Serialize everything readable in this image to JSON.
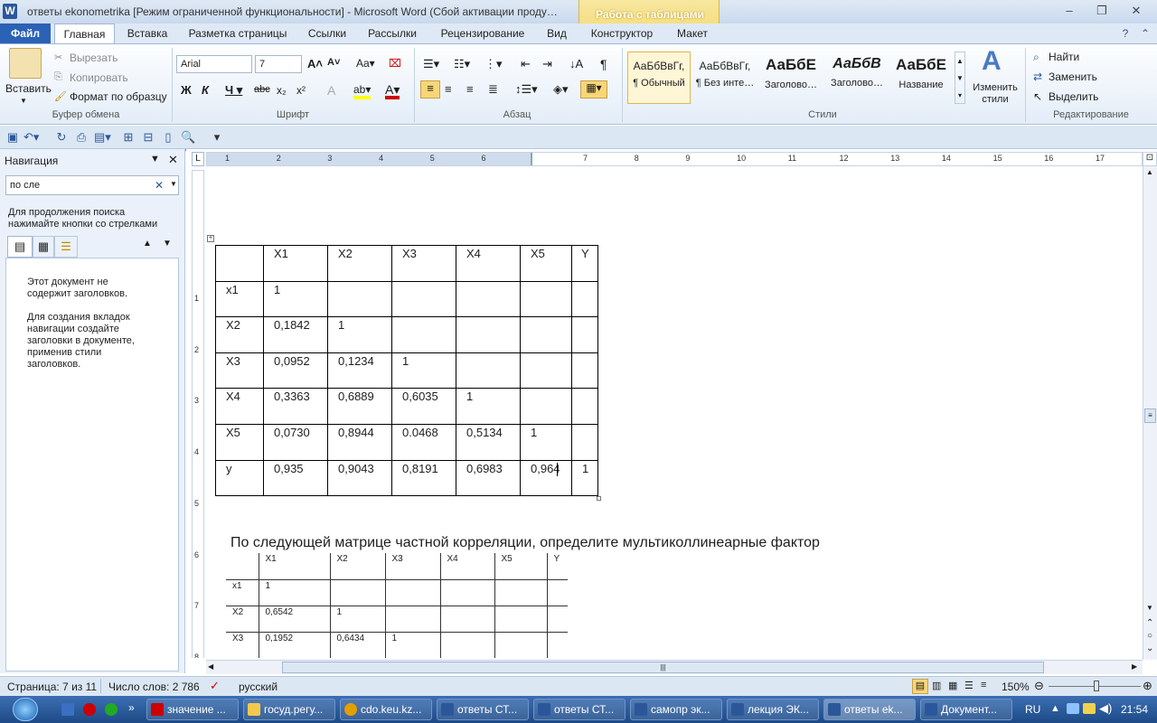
{
  "window": {
    "title": "ответы ekonometrika [Режим ограниченной функциональности]  -  Microsoft Word (Сбой активации проду…",
    "contextual_tab_group": "Работа с таблицами"
  },
  "tabs": [
    "Файл",
    "Главная",
    "Вставка",
    "Разметка страницы",
    "Ссылки",
    "Рассылки",
    "Рецензирование",
    "Вид",
    "Конструктор",
    "Макет"
  ],
  "ribbon": {
    "clipboard": {
      "label": "Буфер обмена",
      "paste": "Вставить",
      "cut": "Вырезать",
      "copy": "Копировать",
      "format_painter": "Формат по образцу"
    },
    "font": {
      "label": "Шрифт",
      "font_name": "Arial",
      "font_size": "7"
    },
    "paragraph": {
      "label": "Абзац"
    },
    "styles": {
      "label": "Стили",
      "items": [
        {
          "sample": "АаБбВвГг,",
          "name": "¶ Обычный"
        },
        {
          "sample": "АаБбВвГг,",
          "name": "¶ Без инте…"
        },
        {
          "sample": "АаБбЕ",
          "name": "Заголово…"
        },
        {
          "sample": "АаБбВ",
          "name": "Заголово…"
        },
        {
          "sample": "АаБбЕ",
          "name": "Название"
        }
      ],
      "change_styles": "Изменить стили"
    },
    "editing": {
      "label": "Редактирование",
      "find": "Найти",
      "replace": "Заменить",
      "select": "Выделить"
    }
  },
  "nav": {
    "title": "Навигация",
    "search_value": "по сле",
    "hint": "Для продолжения поиска нажимайте кнопки со стрелками",
    "no_headings": "Этот документ не содержит заголовков.",
    "create_tabs": "Для создания вкладок навигации создайте заголовки в документе, применив стили заголовков."
  },
  "ruler_numbers": [
    "1",
    "2",
    "3",
    "4",
    "5",
    "6",
    "7",
    "8",
    "9",
    "10",
    "11",
    "12",
    "13",
    "14",
    "15",
    "16",
    "17"
  ],
  "vruler_numbers": [
    "1",
    "2",
    "3",
    "4",
    "5",
    "6",
    "7",
    "8"
  ],
  "table1": {
    "header": [
      "",
      "X1",
      "X2",
      "X3",
      "X4",
      "X5",
      "Y"
    ],
    "rows": [
      [
        "x1",
        "1",
        "",
        "",
        "",
        "",
        ""
      ],
      [
        "X2",
        "0,1842",
        "1",
        "",
        "",
        "",
        ""
      ],
      [
        "X3",
        "0,0952",
        "0,1234",
        "1",
        "",
        "",
        ""
      ],
      [
        "X4",
        "0,3363",
        "0,6889",
        "0,6035",
        "1",
        "",
        ""
      ],
      [
        "X5",
        "0,0730",
        "0,8944",
        "0.0468",
        "0,5134",
        "1",
        ""
      ],
      [
        "y",
        "0,935",
        "0,9043",
        "0,8191",
        "0,6983",
        "0,964",
        "1"
      ]
    ]
  },
  "question": "По следующей матрице частной корреляции, определите мультиколлинеарные фактор",
  "table2": {
    "header": [
      "",
      "X1",
      "X2",
      "X3",
      "X4",
      "X5",
      "Y"
    ],
    "rows": [
      [
        "x1",
        "1",
        "",
        "",
        "",
        "",
        ""
      ],
      [
        "X2",
        "0,6542",
        "1",
        "",
        "",
        "",
        ""
      ],
      [
        "X3",
        "0,1952",
        "0,6434",
        "1",
        "",
        "",
        ""
      ]
    ]
  },
  "status": {
    "page": "Страница: 7 из 11",
    "words": "Число слов: 2 786",
    "language": "русский",
    "zoom": "150%"
  },
  "taskbar": {
    "items": [
      "значение ...",
      "госуд.регу...",
      "cdo.keu.kz...",
      "ответы СТ...",
      "ответы СТ...",
      "самопр эк...",
      "лекция ЭК...",
      "ответы ek...",
      "Документ..."
    ],
    "lang": "RU",
    "time": "21:54"
  }
}
